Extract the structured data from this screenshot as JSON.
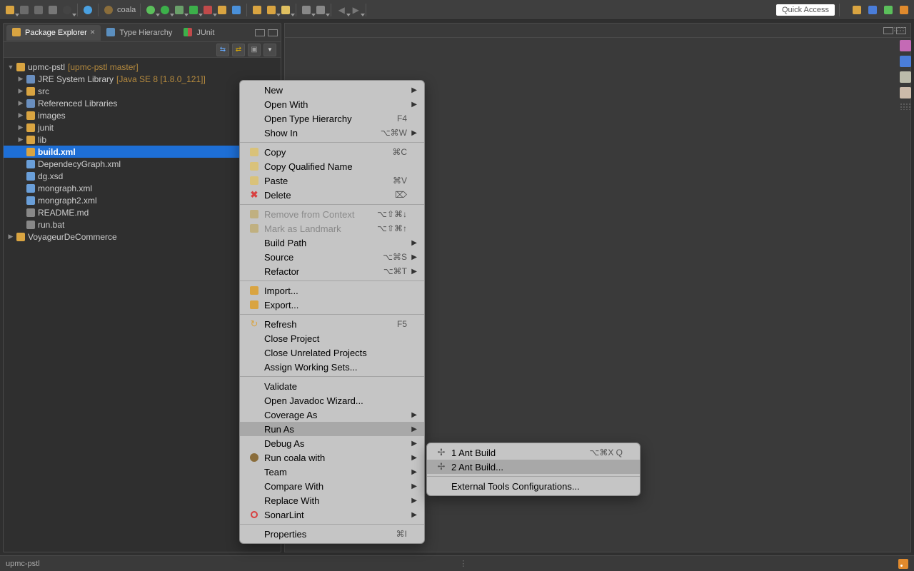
{
  "toolbar": {
    "quick_access": "Quick Access",
    "coala_label": "coala"
  },
  "views": {
    "tabs": [
      {
        "label": "Package Explorer",
        "active": true,
        "closeable": true
      },
      {
        "label": "Type Hierarchy",
        "active": false
      },
      {
        "label": "JUnit",
        "active": false
      }
    ]
  },
  "tree": {
    "root": {
      "label": "upmc-pstl",
      "decoration": "[upmc-pstl master]"
    },
    "children": [
      {
        "label": "JRE System Library",
        "decoration": "[Java SE 8 [1.8.0_121]]",
        "icon": "library"
      },
      {
        "label": "src",
        "icon": "package-folder"
      },
      {
        "label": "Referenced Libraries",
        "icon": "library"
      },
      {
        "label": "images",
        "icon": "folder"
      },
      {
        "label": "junit",
        "icon": "folder"
      },
      {
        "label": "lib",
        "icon": "folder"
      },
      {
        "label": "build.xml",
        "icon": "ant-file",
        "selected": true,
        "leaf": true
      },
      {
        "label": "DependecyGraph.xml",
        "icon": "xml",
        "leaf": true
      },
      {
        "label": "dg.xsd",
        "icon": "xsd",
        "leaf": true
      },
      {
        "label": "mongraph.xml",
        "icon": "xml",
        "leaf": true
      },
      {
        "label": "mongraph2.xml",
        "icon": "xml",
        "leaf": true
      },
      {
        "label": "README.md",
        "icon": "md",
        "leaf": true
      },
      {
        "label": "run.bat",
        "icon": "bat",
        "leaf": true
      }
    ],
    "sibling": {
      "label": "VoyageurDeCommerce",
      "icon": "project"
    }
  },
  "context_menu": {
    "groups": [
      [
        {
          "label": "New",
          "submenu": true
        },
        {
          "label": "Open With",
          "submenu": true
        },
        {
          "label": "Open Type Hierarchy",
          "accel": "F4"
        },
        {
          "label": "Show In",
          "accel": "⌥⌘W",
          "submenu": true
        }
      ],
      [
        {
          "label": "Copy",
          "accel": "⌘C",
          "icon": "copy"
        },
        {
          "label": "Copy Qualified Name",
          "icon": "copy"
        },
        {
          "label": "Paste",
          "accel": "⌘V",
          "icon": "paste"
        },
        {
          "label": "Delete",
          "accel": "⌦",
          "icon": "delete"
        }
      ],
      [
        {
          "label": "Remove from Context",
          "accel": "⌥⇧⌘↓",
          "disabled": true,
          "icon": "remove-ctx"
        },
        {
          "label": "Mark as Landmark",
          "accel": "⌥⇧⌘↑",
          "disabled": true,
          "icon": "landmark"
        },
        {
          "label": "Build Path",
          "submenu": true
        },
        {
          "label": "Source",
          "accel": "⌥⌘S",
          "submenu": true
        },
        {
          "label": "Refactor",
          "accel": "⌥⌘T",
          "submenu": true
        }
      ],
      [
        {
          "label": "Import...",
          "icon": "import"
        },
        {
          "label": "Export...",
          "icon": "export"
        }
      ],
      [
        {
          "label": "Refresh",
          "accel": "F5",
          "icon": "refresh"
        },
        {
          "label": "Close Project"
        },
        {
          "label": "Close Unrelated Projects"
        },
        {
          "label": "Assign Working Sets..."
        }
      ],
      [
        {
          "label": "Validate"
        },
        {
          "label": "Open Javadoc Wizard..."
        },
        {
          "label": "Coverage As",
          "submenu": true
        },
        {
          "label": "Run As",
          "submenu": true,
          "highlight": true
        },
        {
          "label": "Debug As",
          "submenu": true
        },
        {
          "label": "Run coala with",
          "submenu": true,
          "icon": "coala"
        },
        {
          "label": "Team",
          "submenu": true
        },
        {
          "label": "Compare With",
          "submenu": true
        },
        {
          "label": "Replace With",
          "submenu": true
        },
        {
          "label": "SonarLint",
          "submenu": true,
          "icon": "sonar"
        }
      ],
      [
        {
          "label": "Properties",
          "accel": "⌘I"
        }
      ]
    ]
  },
  "submenu": {
    "groups": [
      [
        {
          "label": "1 Ant Build",
          "accel": "⌥⌘X Q",
          "icon": "ant"
        },
        {
          "label": "2 Ant Build...",
          "icon": "ant",
          "highlight": true
        }
      ],
      [
        {
          "label": "External Tools Configurations..."
        }
      ]
    ]
  },
  "statusbar": {
    "project": "upmc-pstl"
  }
}
